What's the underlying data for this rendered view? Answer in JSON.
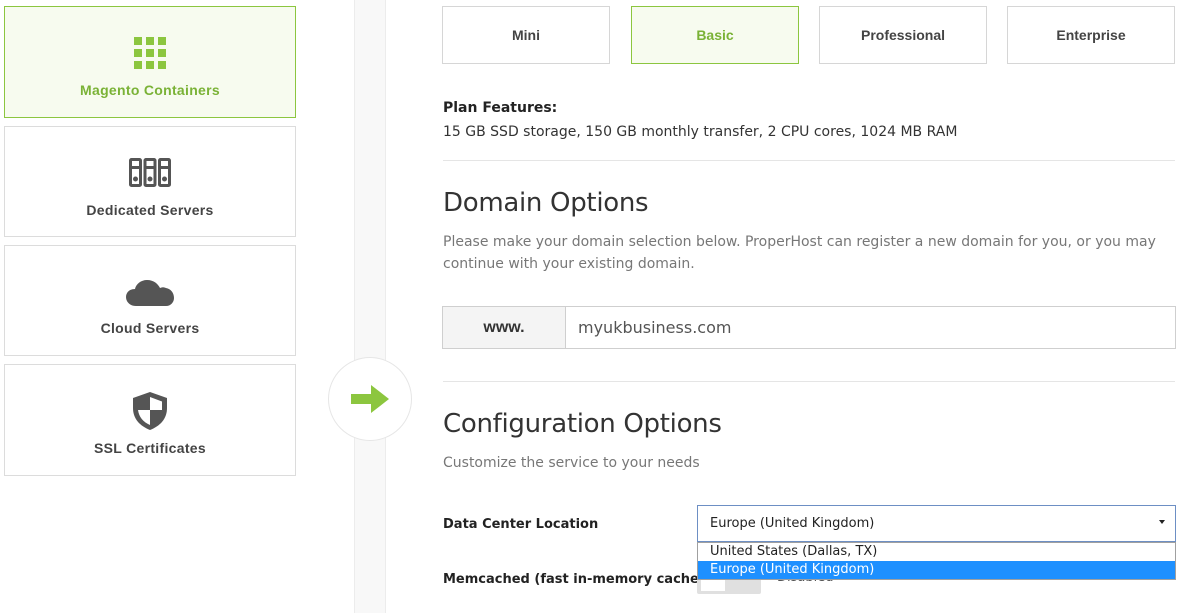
{
  "categories": [
    {
      "label": "Magento Containers",
      "icon": "grid-icon",
      "active": true
    },
    {
      "label": "Dedicated Servers",
      "icon": "servers-icon",
      "active": false
    },
    {
      "label": "Cloud Servers",
      "icon": "cloud-icon",
      "active": false
    },
    {
      "label": "SSL Certificates",
      "icon": "shield-icon",
      "active": false
    }
  ],
  "plans": [
    {
      "label": "Mini",
      "active": false
    },
    {
      "label": "Basic",
      "active": true
    },
    {
      "label": "Professional",
      "active": false
    },
    {
      "label": "Enterprise",
      "active": false
    }
  ],
  "features": {
    "title": "Plan Features:",
    "text": "15 GB SSD storage, 150 GB monthly transfer, 2 CPU cores, 1024 MB RAM"
  },
  "domain": {
    "title": "Domain Options",
    "description": "Please make your domain selection below. ProperHost can register a new domain for you, or you may continue with your existing domain.",
    "prefix": "www.",
    "value": "myukbusiness.com"
  },
  "configuration": {
    "title": "Configuration Options",
    "description": "Customize the service to your needs",
    "datacenter_label": "Data Center Location",
    "datacenter_selected": "Europe (United Kingdom)",
    "datacenter_options": [
      "United States (Dallas, TX)",
      "Europe (United Kingdom)"
    ],
    "memcached_label": "Memcached (fast in-memory cache)",
    "memcached_state": "Disabled"
  },
  "colors": {
    "accent": "#8cc63f",
    "accent_text": "#7ab236",
    "icon_gray": "#555555",
    "highlight": "#1e90ff"
  }
}
